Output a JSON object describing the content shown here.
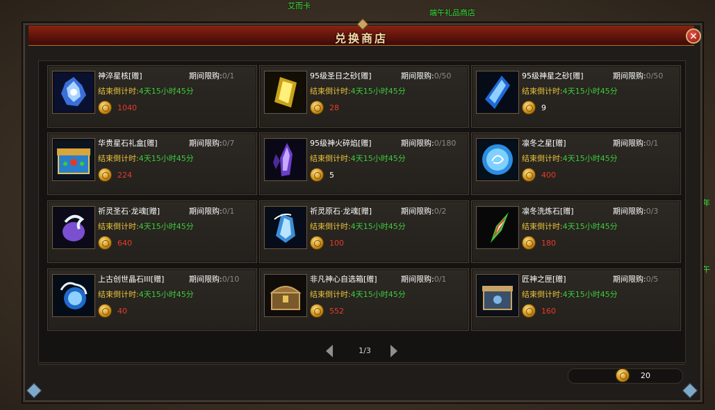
{
  "top_links": {
    "left": "艾而卡",
    "right": "端午礼品商店"
  },
  "window": {
    "title": "兑换商店",
    "close_label": "✕"
  },
  "labels": {
    "limit": "期间限购:",
    "countdown": "结束倒计时:"
  },
  "items": [
    {
      "name": "神淬星核[赠]",
      "limit": "0/1",
      "countdown": "4天15小时45分",
      "price": "1040",
      "price_color": "red",
      "icon": "star-core-icon"
    },
    {
      "name": "95级圣日之砂[赠]",
      "limit": "0/50",
      "countdown": "4天15小时45分",
      "price": "28",
      "price_color": "red",
      "icon": "yellow-crystal-icon"
    },
    {
      "name": "95级神星之砂[赠]",
      "limit": "0/50",
      "countdown": "4天15小时45分",
      "price": "9",
      "price_color": "white",
      "icon": "blue-crystal-icon"
    },
    {
      "name": "华贵星石礼盒[赠]",
      "limit": "0/7",
      "countdown": "4天15小时45分",
      "price": "224",
      "price_color": "red",
      "icon": "gift-box-icon"
    },
    {
      "name": "95级神火碎焰[赠]",
      "limit": "0/180",
      "countdown": "4天15小时45分",
      "price": "5",
      "price_color": "white",
      "icon": "purple-shard-icon"
    },
    {
      "name": "凛冬之星[赠]",
      "limit": "0/1",
      "countdown": "4天15小时45分",
      "price": "400",
      "price_color": "red",
      "icon": "frost-orb-icon"
    },
    {
      "name": "祈灵圣石·龙魂[赠]",
      "limit": "0/1",
      "countdown": "4天15小时45分",
      "price": "640",
      "price_color": "red",
      "icon": "dragon-stone-icon"
    },
    {
      "name": "祈灵原石·龙魂[赠]",
      "limit": "0/2",
      "countdown": "4天15小时45分",
      "price": "100",
      "price_color": "red",
      "icon": "dragon-crystal-icon"
    },
    {
      "name": "凛冬洗炼石[赠]",
      "limit": "0/3",
      "countdown": "4天15小时45分",
      "price": "180",
      "price_color": "red",
      "icon": "refine-stone-icon"
    },
    {
      "name": "上古创世晶石III[赠]",
      "limit": "0/10",
      "countdown": "4天15小时45分",
      "price": "40",
      "price_color": "red",
      "icon": "ancient-orb-icon"
    },
    {
      "name": "非凡神心自选箱[赠]",
      "limit": "0/1",
      "countdown": "4天15小时45分",
      "price": "552",
      "price_color": "red",
      "icon": "treasure-chest-icon"
    },
    {
      "name": "匠神之匣[赠]",
      "limit": "0/5",
      "countdown": "4天15小时45分",
      "price": "160",
      "price_color": "red",
      "icon": "artisan-box-icon"
    }
  ],
  "pager": {
    "page": "1/3"
  },
  "wallet": {
    "amount": "20"
  },
  "side_text": {
    "a": "年",
    "b": "午"
  },
  "colors": {
    "title_bar": "#7a1d0e",
    "countdown_key": "#e8c23b",
    "countdown_val": "#3ccb3c",
    "price_red": "#e83a2a"
  }
}
